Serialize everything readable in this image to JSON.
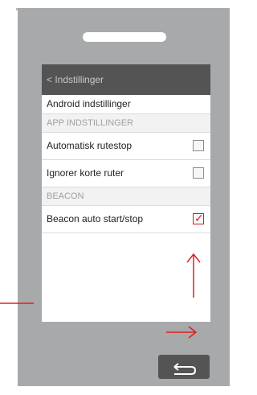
{
  "screen": {
    "back_link": "< Indstillinger",
    "android_settings": "Android indstillinger",
    "section_app": "APP INDSTILLINGER",
    "items_app": [
      {
        "label": "Automatisk rutestop",
        "checked": false
      },
      {
        "label": "Ignorer korte ruter",
        "checked": false
      }
    ],
    "section_beacon": "BEACON",
    "beacon_item": {
      "label": "Beacon auto start/stop",
      "checked": true
    },
    "checkmark_glyph": "✓"
  },
  "colors": {
    "phone_body": "#a7a9ab",
    "header_bg": "#545454",
    "annotation_red": "#e02020"
  }
}
